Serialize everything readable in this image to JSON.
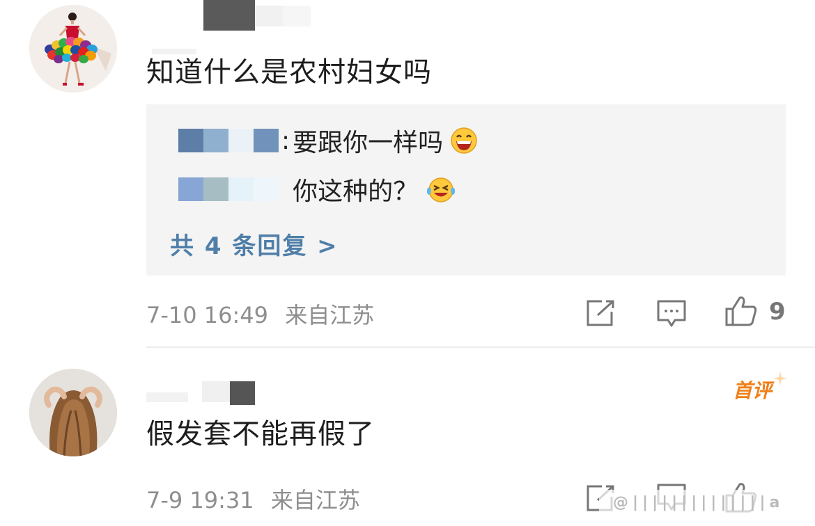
{
  "comments": [
    {
      "text": "知道什么是农村妇女吗",
      "time": "7-10 16:49",
      "location": "来自江苏",
      "like_count": "9",
      "replies": [
        {
          "sep": ":",
          "text": "要跟你一样吗",
          "emoji": "grinning-face-icon"
        },
        {
          "sep": ":",
          "text": "你这种的？",
          "emoji": "laughing-tears-icon"
        }
      ],
      "more_replies": "共 4 条回复 >"
    },
    {
      "text": "假发套不能再假了",
      "time": "7-9 19:31",
      "location": "来自江苏",
      "badge": "首评"
    }
  ],
  "watermark": "@||||||||||||||a",
  "colors": {
    "link": "#4f7fa9",
    "badge": "#f07f18",
    "meta": "#8e8e8e",
    "reply_bg": "#f4f4f4"
  }
}
